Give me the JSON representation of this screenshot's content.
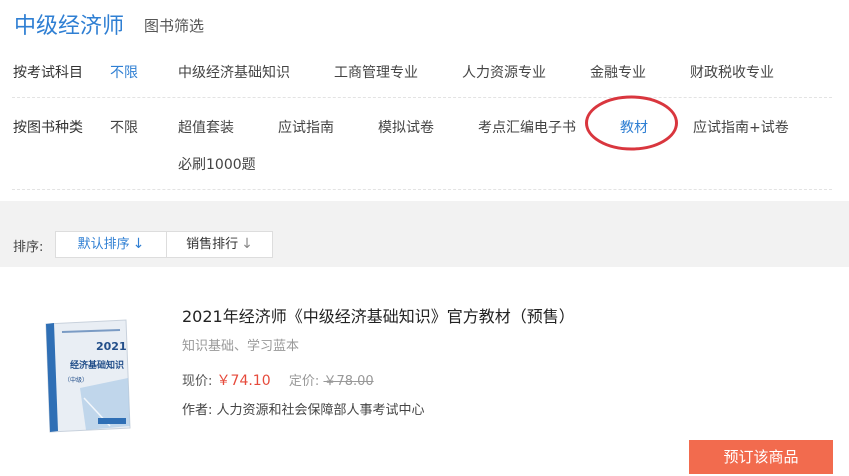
{
  "header": {
    "title": "中级经济师",
    "subtitle": "图书筛选"
  },
  "filters": {
    "subject": {
      "label": "按考试科目",
      "options": [
        "不限",
        "中级经济基础知识",
        "工商管理专业",
        "人力资源专业",
        "金融专业",
        "财政税收专业"
      ],
      "active": "不限"
    },
    "book_type": {
      "label": "按图书种类",
      "options": [
        "不限",
        "超值套装",
        "应试指南",
        "模拟试卷",
        "考点汇编电子书",
        "教材",
        "应试指南+试卷",
        "必刷1000题"
      ],
      "active": "教材"
    }
  },
  "sort": {
    "label": "排序:",
    "default_label": "默认排序",
    "sales_label": "销售排行"
  },
  "product": {
    "title": "2021年经济师《中级经济基础知识》官方教材（预售）",
    "tags": "知识基础、学习蓝本",
    "price_now_label": "现价:",
    "price_now": "￥74.10",
    "price_list_label": "定价:",
    "price_list": "￥78.00",
    "author_label": "作者:",
    "author": "人力资源和社会保障部人事考试中心",
    "order_button": "预订该商品",
    "cover": {
      "year": "2021",
      "name": "经济基础知识",
      "level": "（中级）"
    }
  },
  "colors": {
    "accent": "#2f7fd3",
    "price": "#e64a3b",
    "button": "#f26b4e",
    "highlight_circle": "#d9363e"
  }
}
